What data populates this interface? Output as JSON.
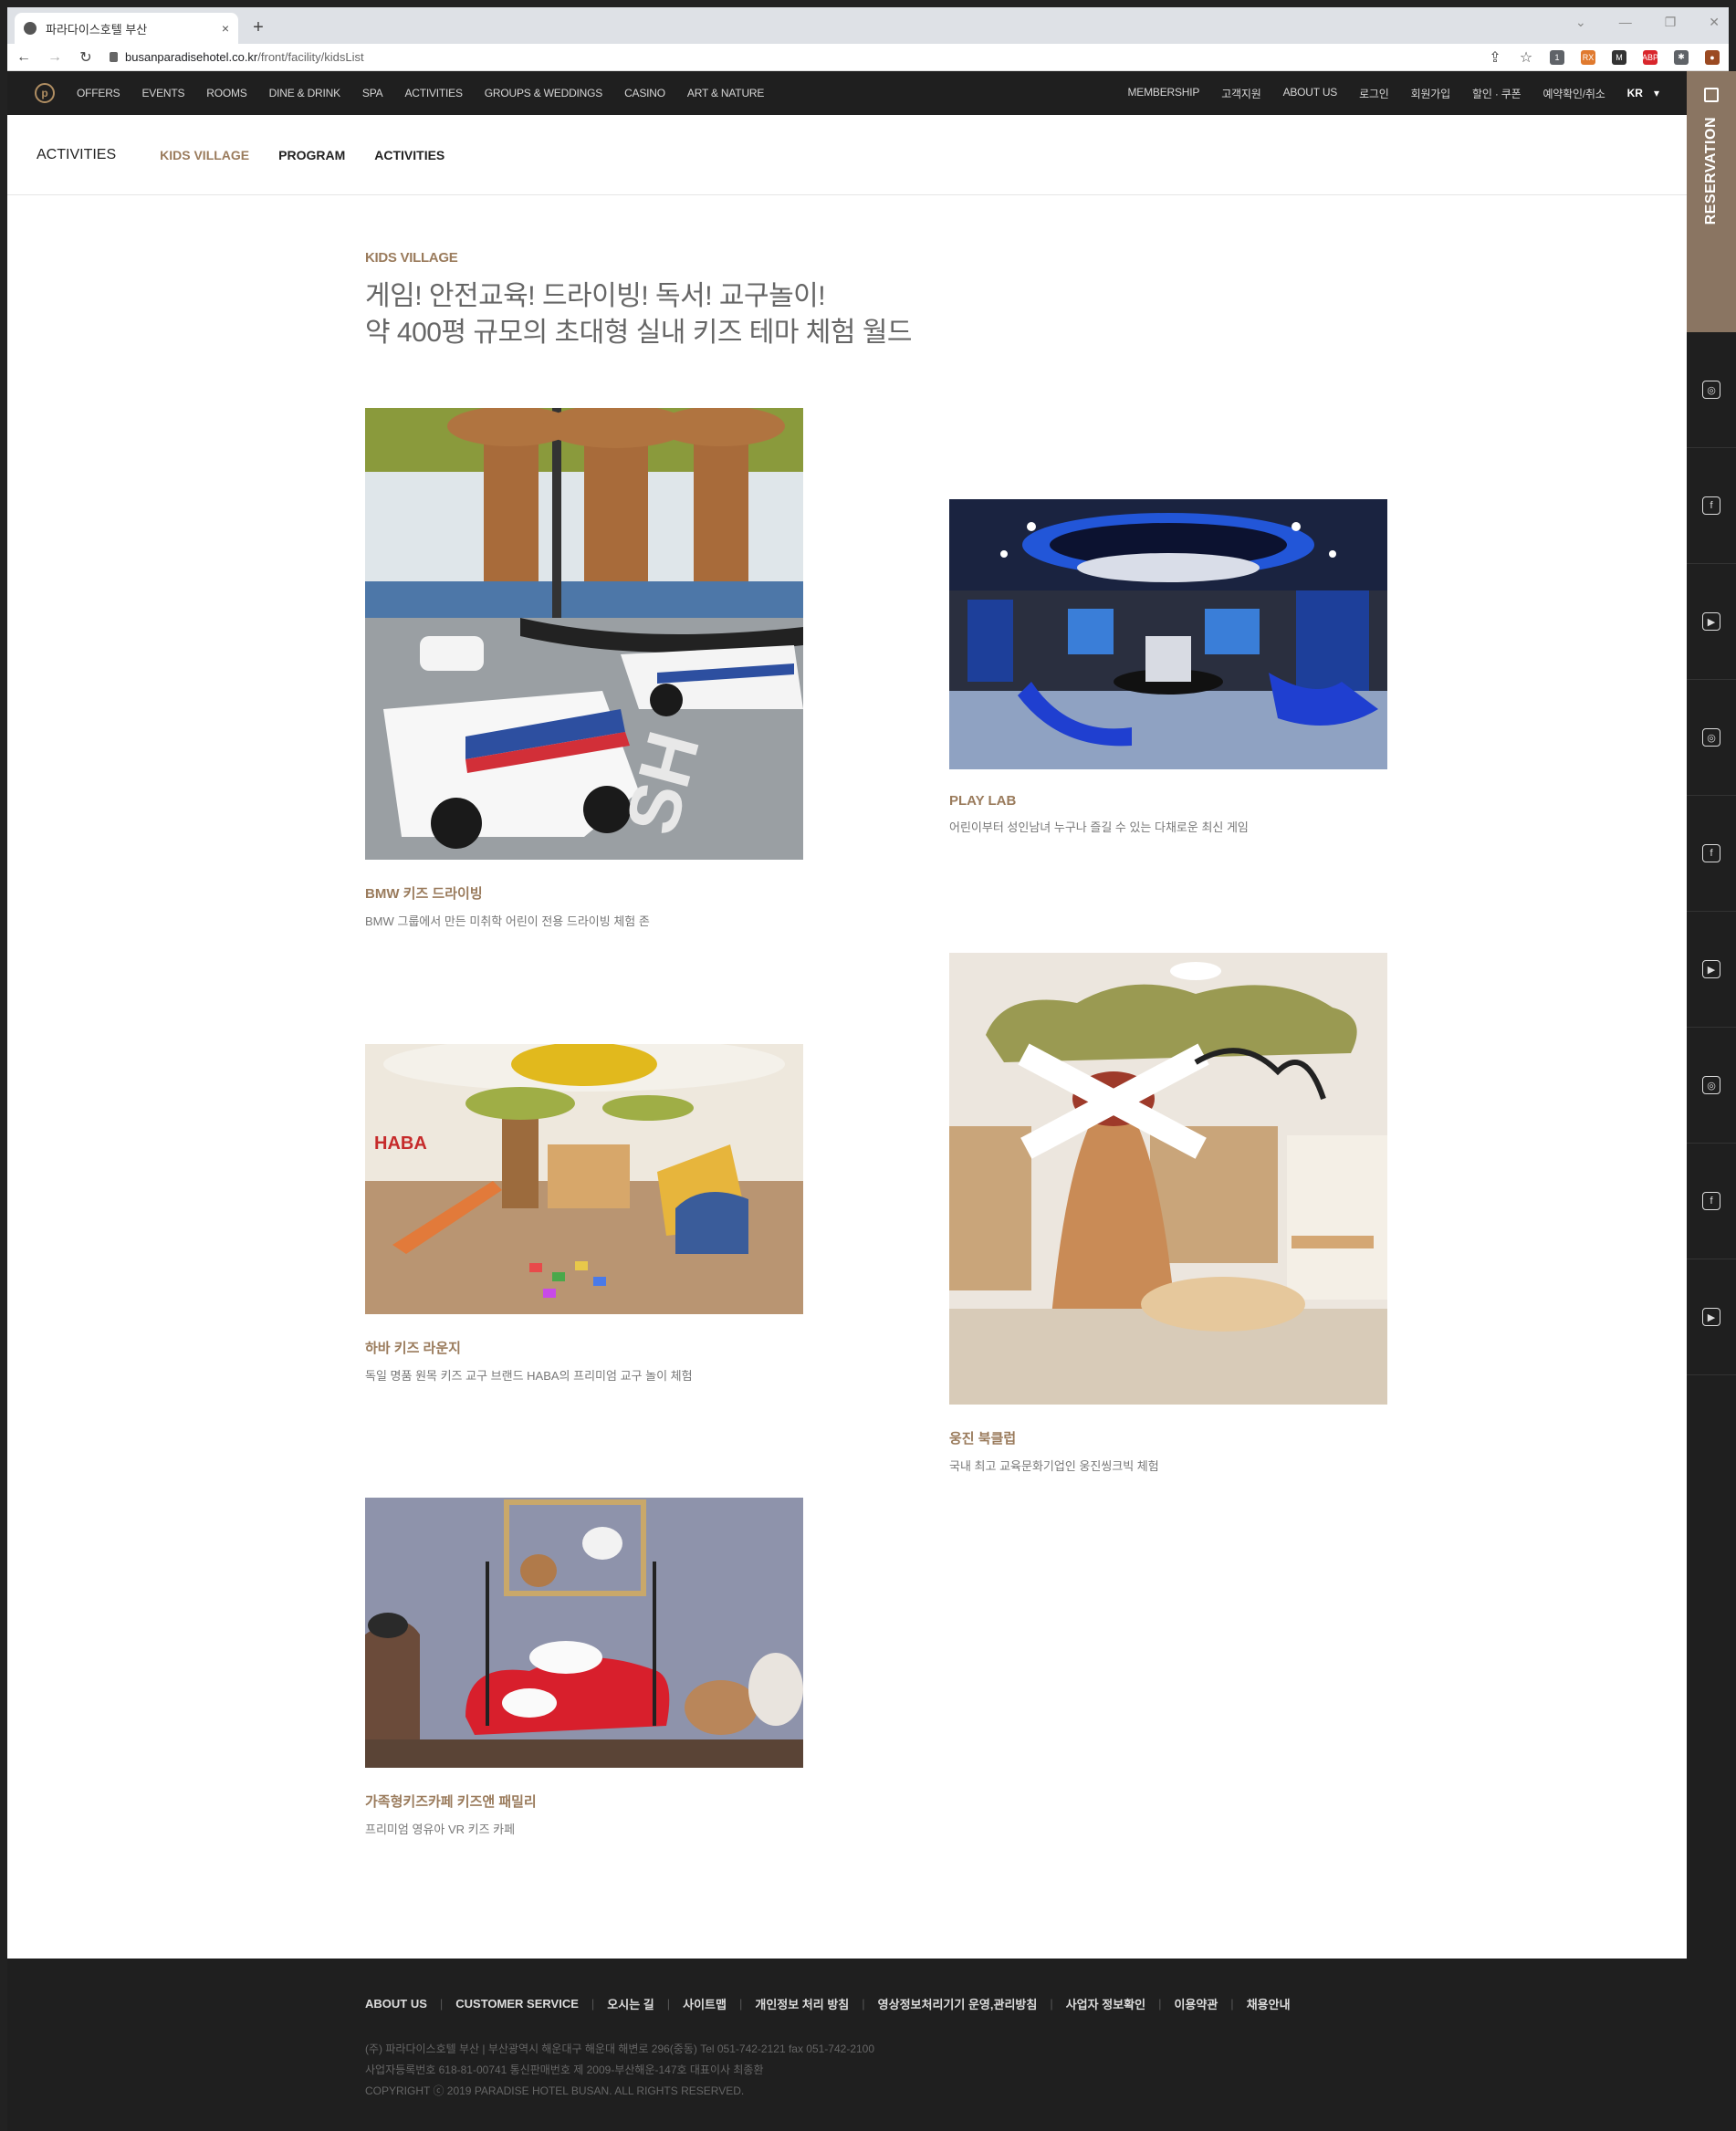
{
  "browser": {
    "tab_title": "파라다이스호텔 부산",
    "tab_close": "×",
    "new_tab": "+",
    "url_host": "busanparadisehotel.co.kr",
    "url_path": "/front/facility/kidsList",
    "window_controls": [
      "⌄",
      "—",
      "❐",
      "✕"
    ],
    "nav_back": "←",
    "nav_forward": "→",
    "nav_reload": "↻",
    "extensions": [
      {
        "label": "1",
        "color": "#5f6368"
      },
      {
        "label": "RX",
        "color": "#e07a2f"
      },
      {
        "label": "M",
        "color": "#333333"
      },
      {
        "label": "ABP",
        "color": "#d9262c"
      },
      {
        "label": "✱",
        "color": "#5f6368"
      },
      {
        "label": "●",
        "color": "#9b4a22"
      }
    ]
  },
  "topnav": {
    "logo": "p",
    "menu": [
      "OFFERS",
      "EVENTS",
      "ROOMS",
      "DINE & DRINK",
      "SPA",
      "ACTIVITIES",
      "GROUPS & WEDDINGS",
      "CASINO",
      "ART & NATURE"
    ],
    "util": [
      "MEMBERSHIP",
      "고객지원",
      "ABOUT US",
      "로그인",
      "회원가입",
      "할인 · 쿠폰",
      "예약확인/취소"
    ],
    "lang": "KR",
    "lang_caret": "▾"
  },
  "subnav": {
    "section": "ACTIVITIES",
    "items": [
      "KIDS VILLAGE",
      "PROGRAM",
      "ACTIVITIES"
    ]
  },
  "intro": {
    "eyebrow": "KIDS VILLAGE",
    "headline_line1": "게임! 안전교육! 드라이빙! 독서! 교구놀이!",
    "headline_line2": "약 400평 규모의 초대형 실내 키즈 테마 체험 월드"
  },
  "cards": [
    {
      "title": "BMW 키즈 드라이빙",
      "desc": "BMW 그룹에서 만든 미취학 어린이 전용 드라이빙 체험 존"
    },
    {
      "title": "PLAY LAB",
      "desc": "어린이부터 성인남녀 누구나 즐길 수 있는 다채로운 최신 게임"
    },
    {
      "title": "하바 키즈 라운지",
      "desc": "독일 명품 원목 키즈 교구 브랜드 HABA의 프리미엄 교구 놀이 체험"
    },
    {
      "title": "웅진 북클럽",
      "desc": "국내 최고 교육문화기업인 웅진씽크빅 체험"
    },
    {
      "title": "가족형키즈카페 키즈앤 패밀리",
      "desc": "프리미엄 영유아 VR 키즈 카페"
    }
  ],
  "sidebar": {
    "reservation": "RESERVATION",
    "sns": [
      "◎",
      "f",
      "▶",
      "◎",
      "f",
      "▶",
      "◎",
      "f",
      "▶"
    ]
  },
  "footer": {
    "links": [
      "ABOUT US",
      "CUSTOMER SERVICE",
      "오시는 길",
      "사이트맵",
      "개인정보 처리 방침",
      "영상정보처리기기 운영,관리방침",
      "사업자 정보확인",
      "이용약관",
      "채용안내"
    ],
    "separator": "|",
    "copy1": "(주) 파라다이스호텔 부산 | 부산광역시 해운대구 해운대 해변로 296(중동) Tel 051-742-2121 fax 051-742-2100",
    "copy2": "사업자등록번호 618-81-00741 통신판매번호 제 2009-부산해운-147호 대표이사 최종환",
    "copy3": "COPYRIGHT ⓒ 2019 PARADISE HOTEL BUSAN. ALL RIGHTS RESERVED."
  }
}
